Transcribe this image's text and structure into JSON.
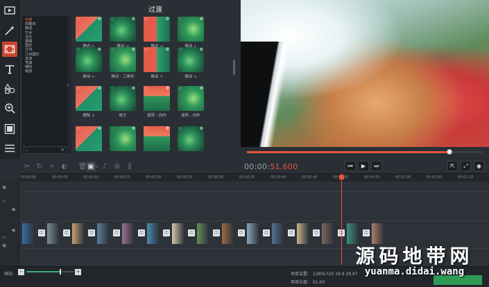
{
  "panel": {
    "title": "过渡"
  },
  "categories": [
    {
      "label": "全部",
      "selected": true
    },
    {
      "label": "收藏夹"
    },
    {
      "label": "精选"
    },
    {
      "label": "艺术"
    },
    {
      "label": "淡化"
    },
    {
      "label": "模糊"
    },
    {
      "label": "圆形"
    },
    {
      "label": "方块"
    },
    {
      "label": "几何图形"
    },
    {
      "label": "波浪"
    },
    {
      "label": "弯曲"
    },
    {
      "label": "擦除"
    },
    {
      "label": "缩放"
    }
  ],
  "transitions": [
    {
      "label": "静态 ←",
      "style": "t-a"
    },
    {
      "label": "推动 →",
      "style": "t-b"
    },
    {
      "label": "推动 →",
      "style": "t-c"
    },
    {
      "label": "推动 ↓",
      "style": "t-d"
    },
    {
      "label": "推动 ←",
      "style": "t-b"
    },
    {
      "label": "推动 - 三角形",
      "style": "t-d"
    },
    {
      "label": "推动 ↗",
      "style": "t-c"
    },
    {
      "label": "推动 ↘",
      "style": "t-b"
    },
    {
      "label": "擦除 ↓",
      "style": "t-a"
    },
    {
      "label": "放大",
      "style": "t-b"
    },
    {
      "label": "旋转 - 向内",
      "style": "t-e"
    },
    {
      "label": "旋转 - 向外",
      "style": "t-d"
    },
    {
      "label": "",
      "style": "t-a"
    },
    {
      "label": "",
      "style": "t-d"
    },
    {
      "label": "",
      "style": "t-e"
    },
    {
      "label": "",
      "style": "t-b"
    }
  ],
  "player": {
    "timecode_prefix": "00:00:",
    "timecode_highlight": "51.600",
    "progress": 0.86,
    "buttons": [
      "previous-icon",
      "play-icon",
      "next-icon"
    ]
  },
  "ruler": [
    "00:00:00",
    "00:00:05",
    "00:00:10",
    "00:00:15",
    "00:00:20",
    "00:00:25",
    "00:00:30",
    "00:00:35",
    "00:00:40",
    "00:00:45",
    "00:00:50",
    "00:00:55",
    "00:01:00",
    "00:01:05",
    "00:01:10"
  ],
  "zoom": {
    "label": "缩放:",
    "minus": "−",
    "plus": "+",
    "level": 0.72
  },
  "project": {
    "settings": "项目设置：  1280x720 16:9 29.97",
    "length": "项目长度：  01:00"
  },
  "colors": {
    "accent": "#e8553a",
    "panel": "#2a2f35",
    "active_tool": "#c9462d"
  },
  "watermark": {
    "cn": "源码地带网",
    "en": "yuanma.didai.wang"
  }
}
